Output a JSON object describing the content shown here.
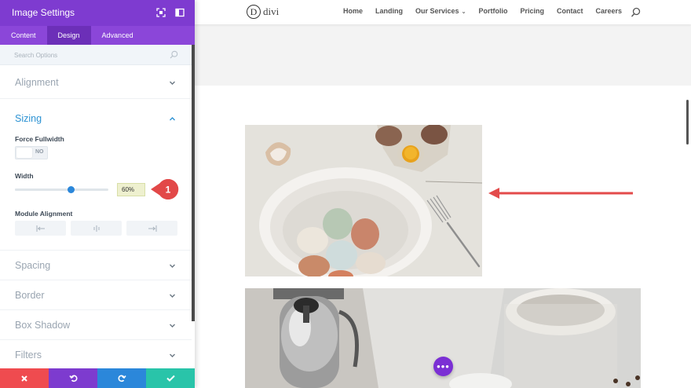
{
  "panel": {
    "title": "Image Settings",
    "tabs": [
      {
        "label": "Content",
        "active": false
      },
      {
        "label": "Design",
        "active": true
      },
      {
        "label": "Advanced",
        "active": false
      }
    ],
    "search_placeholder": "Search Options",
    "sections": {
      "alignment": "Alignment",
      "sizing": "Sizing",
      "spacing": "Spacing",
      "border": "Border",
      "box_shadow": "Box Shadow",
      "filters": "Filters"
    },
    "force_fullwidth": {
      "label": "Force Fullwidth",
      "value": "NO"
    },
    "width": {
      "label": "Width",
      "value": "60%",
      "fraction": 0.6
    },
    "module_alignment": {
      "label": "Module Alignment",
      "options": [
        "left",
        "center",
        "right"
      ]
    },
    "callout_number": "1",
    "footer_buttons": [
      {
        "name": "discard",
        "icon": "close-icon",
        "color": "#ef4b4f"
      },
      {
        "name": "undo",
        "icon": "undo-icon",
        "color": "#7d3bcf"
      },
      {
        "name": "redo",
        "icon": "redo-icon",
        "color": "#2b87da"
      },
      {
        "name": "save",
        "icon": "check-icon",
        "color": "#29c4a9"
      }
    ]
  },
  "site": {
    "logo_letter": "D",
    "logo_text": "divi",
    "nav": [
      "Home",
      "Landing",
      "Our Services",
      "Portfolio",
      "Pricing",
      "Contact",
      "Careers"
    ]
  },
  "colors": {
    "header_purple": "#7e3bd0",
    "accent_blue": "#2c92d3",
    "arrow_red": "#e34b4b"
  }
}
